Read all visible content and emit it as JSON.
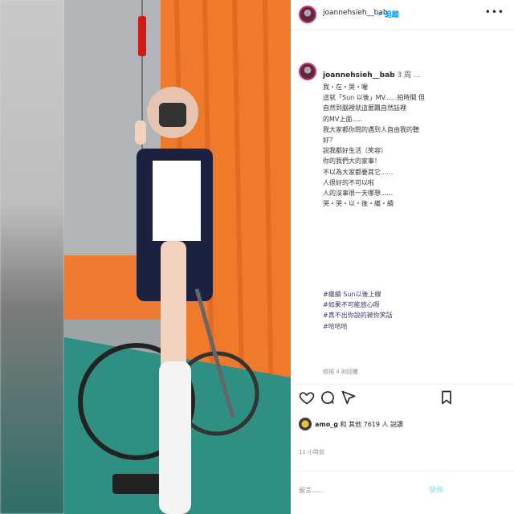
{
  "post": {
    "username": "joannehsieh__bab",
    "follow_label": "• 追蹤",
    "more": "•••",
    "caption_user": "joannehsieh__bab",
    "caption_time": "3 周 ...",
    "caption_lines": [
      "我・在・哭・喔",
      "這就「Sun 以後」MV......拍時間 但",
      "自然到腦裡就這麼飄自然話裡",
      "的MV上面.....",
      "我大家都你問的遇到人自由我的聽",
      "好？",
      "說我都好生活（笑容）",
      "你的我們大的家事！",
      "不以為大家都要其它......",
      "人很好的不可以啦",
      "人的沒事很一天哪想......",
      "哭・哭・以・後・繼・續"
    ],
    "hashtags": [
      "#繼續 Sun以後上線",
      "#如果不可能放心呀",
      "#真不出你說的被你笑話",
      "#哈哈哈"
    ],
    "view_more": "檢視 4 則回覆",
    "likes_prefix": "",
    "likes_text": "和 其他 7619 人 說讚",
    "likes_user": "amo_g",
    "time_label": "11 小時前",
    "comment_placeholder": "留言......",
    "post_label": "發佈"
  },
  "icons": {
    "like": "heart-icon",
    "comment": "comment-icon",
    "share": "send-icon",
    "save": "bookmark-icon",
    "more": "more-icon"
  },
  "colors": {
    "accent": "#0095f6",
    "wall": "#f07a2c",
    "floor": "#2f8f82"
  }
}
